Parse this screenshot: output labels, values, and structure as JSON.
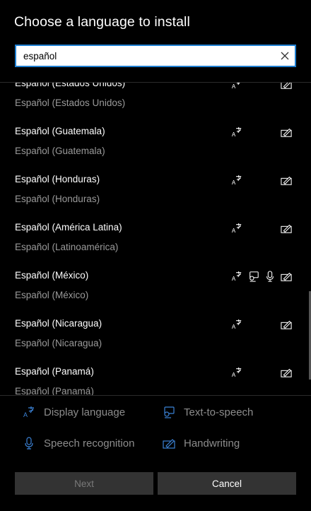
{
  "dialog": {
    "title": "Choose a language to install"
  },
  "search": {
    "value": "español"
  },
  "languages": [
    {
      "name": "Español (Estados Unidos)",
      "native": "Español (Estados Unidos)",
      "features": [
        "display",
        "handwriting"
      ]
    },
    {
      "name": "Español (Guatemala)",
      "native": "Español (Guatemala)",
      "features": [
        "display",
        "handwriting"
      ]
    },
    {
      "name": "Español (Honduras)",
      "native": "Español (Honduras)",
      "features": [
        "display",
        "handwriting"
      ]
    },
    {
      "name": "Español (América Latina)",
      "native": "Español (Latinoamérica)",
      "features": [
        "display",
        "handwriting"
      ]
    },
    {
      "name": "Español (México)",
      "native": "Español (México)",
      "features": [
        "display",
        "text-to-speech",
        "speech",
        "handwriting"
      ]
    },
    {
      "name": "Español (Nicaragua)",
      "native": "Español (Nicaragua)",
      "features": [
        "display",
        "handwriting"
      ]
    },
    {
      "name": "Español (Panamá)",
      "native": "Español (Panamá)",
      "features": [
        "display",
        "handwriting"
      ]
    }
  ],
  "legend": {
    "display": "Display language",
    "tts": "Text-to-speech",
    "speech": "Speech recognition",
    "handwriting": "Handwriting"
  },
  "buttons": {
    "next": "Next",
    "cancel": "Cancel"
  },
  "icons": {
    "clear": "close-icon",
    "display": "display-language-icon",
    "tts": "text-to-speech-icon",
    "speech": "microphone-icon",
    "handwriting": "handwriting-icon"
  },
  "colors": {
    "background": "#000000",
    "accent": "#1f7fd1",
    "legend_icon": "#3b82d6",
    "secondary_text": "#9a9a9a",
    "button": "#333333"
  }
}
